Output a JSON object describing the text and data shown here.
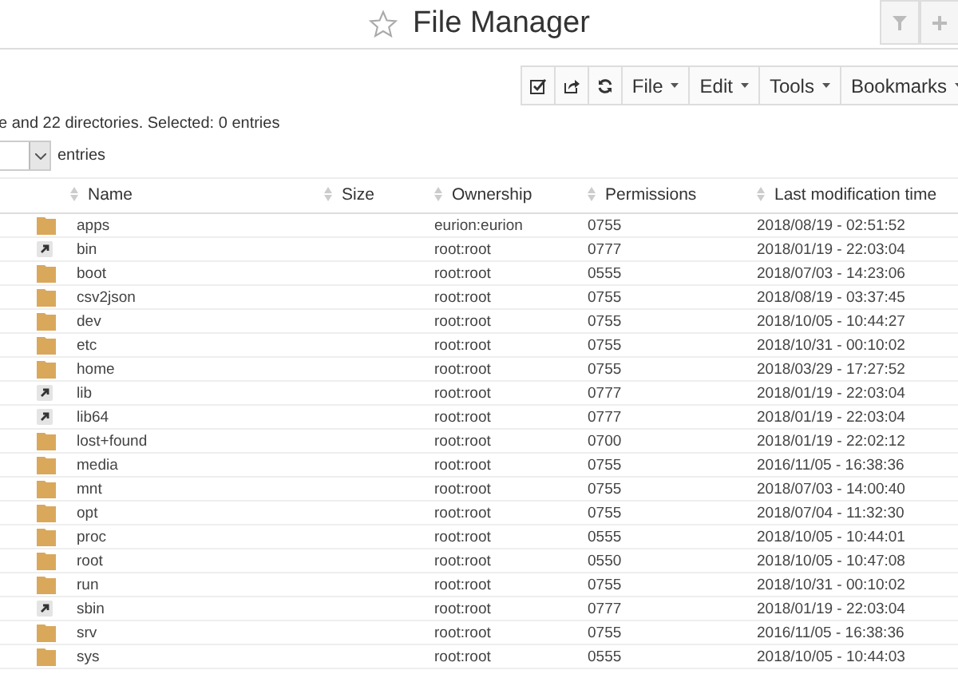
{
  "header": {
    "title": "File Manager"
  },
  "toolbar": {
    "menus": [
      "File",
      "Edit",
      "Tools",
      "Bookmarks"
    ]
  },
  "summary": "e and 22 directories. Selected: 0 entries",
  "page_length": {
    "label": "entries"
  },
  "table": {
    "columns": [
      "Name",
      "Size",
      "Ownership",
      "Permissions",
      "Last modification time"
    ],
    "rows": [
      {
        "kind": "folder",
        "name": "apps",
        "owner": "eurion:eurion",
        "perm": "0755",
        "time": "2018/08/19 - 02:51:52"
      },
      {
        "kind": "link",
        "name": "bin",
        "owner": "root:root",
        "perm": "0777",
        "time": "2018/01/19 - 22:03:04"
      },
      {
        "kind": "folder",
        "name": "boot",
        "owner": "root:root",
        "perm": "0555",
        "time": "2018/07/03 - 14:23:06"
      },
      {
        "kind": "folder",
        "name": "csv2json",
        "owner": "root:root",
        "perm": "0755",
        "time": "2018/08/19 - 03:37:45"
      },
      {
        "kind": "folder",
        "name": "dev",
        "owner": "root:root",
        "perm": "0755",
        "time": "2018/10/05 - 10:44:27"
      },
      {
        "kind": "folder",
        "name": "etc",
        "owner": "root:root",
        "perm": "0755",
        "time": "2018/10/31 - 00:10:02"
      },
      {
        "kind": "folder",
        "name": "home",
        "owner": "root:root",
        "perm": "0755",
        "time": "2018/03/29 - 17:27:52"
      },
      {
        "kind": "link",
        "name": "lib",
        "owner": "root:root",
        "perm": "0777",
        "time": "2018/01/19 - 22:03:04"
      },
      {
        "kind": "link",
        "name": "lib64",
        "owner": "root:root",
        "perm": "0777",
        "time": "2018/01/19 - 22:03:04"
      },
      {
        "kind": "folder",
        "name": "lost+found",
        "owner": "root:root",
        "perm": "0700",
        "time": "2018/01/19 - 22:02:12"
      },
      {
        "kind": "folder",
        "name": "media",
        "owner": "root:root",
        "perm": "0755",
        "time": "2016/11/05 - 16:38:36"
      },
      {
        "kind": "folder",
        "name": "mnt",
        "owner": "root:root",
        "perm": "0755",
        "time": "2018/07/03 - 14:00:40"
      },
      {
        "kind": "folder",
        "name": "opt",
        "owner": "root:root",
        "perm": "0755",
        "time": "2018/07/04 - 11:32:30"
      },
      {
        "kind": "folder",
        "name": "proc",
        "owner": "root:root",
        "perm": "0555",
        "time": "2018/10/05 - 10:44:01"
      },
      {
        "kind": "folder",
        "name": "root",
        "owner": "root:root",
        "perm": "0550",
        "time": "2018/10/05 - 10:47:08"
      },
      {
        "kind": "folder",
        "name": "run",
        "owner": "root:root",
        "perm": "0755",
        "time": "2018/10/31 - 00:10:02"
      },
      {
        "kind": "link",
        "name": "sbin",
        "owner": "root:root",
        "perm": "0777",
        "time": "2018/01/19 - 22:03:04"
      },
      {
        "kind": "folder",
        "name": "srv",
        "owner": "root:root",
        "perm": "0755",
        "time": "2016/11/05 - 16:38:36"
      },
      {
        "kind": "folder",
        "name": "sys",
        "owner": "root:root",
        "perm": "0555",
        "time": "2018/10/05 - 10:44:03"
      }
    ]
  }
}
